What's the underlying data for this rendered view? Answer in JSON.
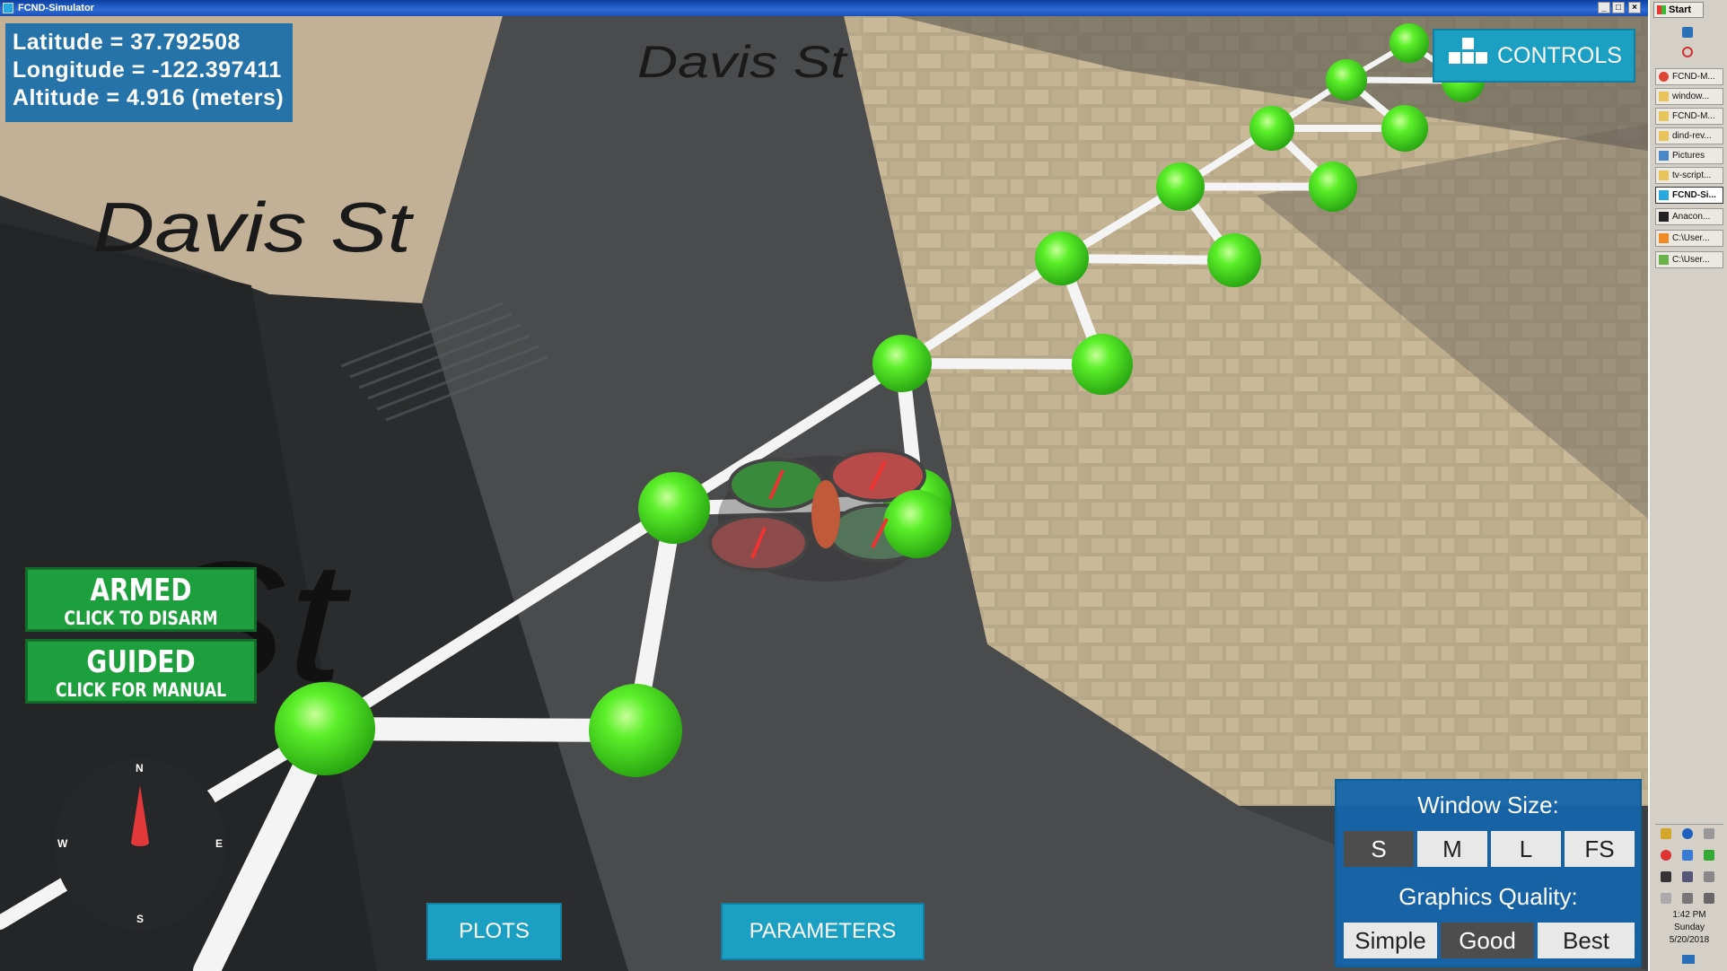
{
  "window": {
    "title": "FCND-Simulator"
  },
  "geo": {
    "latitude": "Latitude = 37.792508",
    "longitude": "Longitude = -122.397411",
    "altitude": "Altitude = 4.916 (meters)"
  },
  "scene": {
    "street_label_1": "Davis St",
    "street_label_2": "Davis St",
    "street_label_3": "St"
  },
  "controls_label": "CONTROLS",
  "armed": {
    "title": "ARMED",
    "action": "CLICK TO DISARM"
  },
  "guided": {
    "title": "GUIDED",
    "action": "CLICK FOR MANUAL"
  },
  "compass": {
    "n": "N",
    "e": "E",
    "s": "S",
    "w": "W"
  },
  "buttons": {
    "plots": "PLOTS",
    "parameters": "PARAMETERS"
  },
  "window_size": {
    "header": "Window Size:",
    "options": [
      "S",
      "M",
      "L",
      "FS"
    ],
    "selected": "S"
  },
  "graphics_quality": {
    "header": "Graphics Quality:",
    "options": [
      "Simple",
      "Good",
      "Best"
    ],
    "selected": "Good"
  },
  "taskbar": {
    "start": "Start",
    "items": [
      {
        "label": "FCND-M...",
        "icon": "chrome-icon",
        "active": false
      },
      {
        "label": "window...",
        "icon": "folder-icon",
        "active": false
      },
      {
        "label": "FCND-M...",
        "icon": "folder-icon",
        "active": false
      },
      {
        "label": "dind-rev...",
        "icon": "folder-icon",
        "active": false
      },
      {
        "label": "Pictures",
        "icon": "pictures-icon",
        "active": false
      },
      {
        "label": "tv-script...",
        "icon": "folder-icon",
        "active": false
      },
      {
        "label": "FCND-Si...",
        "icon": "unity-icon",
        "active": true
      },
      {
        "label": "Anacon...",
        "icon": "terminal-icon",
        "active": false
      },
      {
        "label": "C:\\User...",
        "icon": "sublime-icon",
        "active": false
      },
      {
        "label": "C:\\User...",
        "icon": "notepad-icon",
        "active": false
      }
    ],
    "clock": {
      "time": "1:42 PM",
      "day": "Sunday",
      "date": "5/20/2018"
    }
  }
}
